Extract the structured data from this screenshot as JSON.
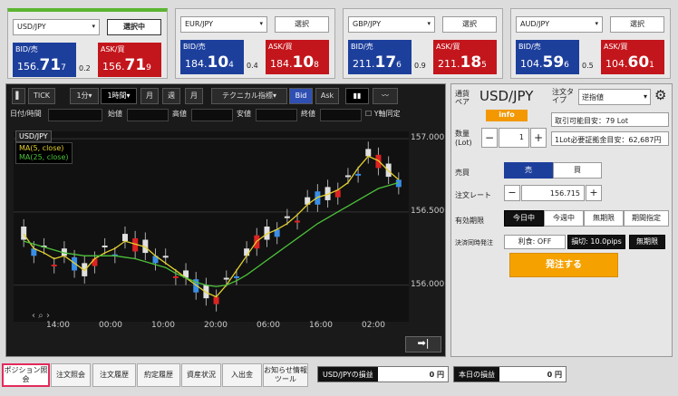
{
  "panels": [
    {
      "pair": "USD/JPY",
      "button": "選択中",
      "bid_label": "BID/売",
      "ask_label": "ASK/買",
      "bid": [
        "156.",
        "71",
        "7"
      ],
      "ask": [
        "156.",
        "71",
        "9"
      ],
      "spread": "0.2"
    },
    {
      "pair": "EUR/JPY",
      "button": "選択",
      "bid_label": "BID/売",
      "ask_label": "ASK/買",
      "bid": [
        "184.",
        "10",
        "4"
      ],
      "ask": [
        "184.",
        "10",
        "8"
      ],
      "spread": "0.4"
    },
    {
      "pair": "GBP/JPY",
      "button": "選択",
      "bid_label": "BID/売",
      "ask_label": "ASK/買",
      "bid": [
        "211.",
        "17",
        "6"
      ],
      "ask": [
        "211.",
        "18",
        "5"
      ],
      "spread": "0.9"
    },
    {
      "pair": "AUD/JPY",
      "button": "選択",
      "bid_label": "BID/売",
      "ask_label": "ASK/買",
      "bid": [
        "104.",
        "59",
        "6"
      ],
      "ask": [
        "104.",
        "60",
        "1"
      ],
      "spread": "0.5"
    }
  ],
  "chart_toolbar": {
    "tick": "TICK",
    "interval1": "1分",
    "interval2": "1時間",
    "month": "月",
    "week": "週",
    "month2": "月",
    "technical": "テクニカル指標",
    "bid": "Bid",
    "ask": "Ask"
  },
  "ohlc": {
    "datetime": "日付/時間",
    "open": "始値",
    "high": "高値",
    "low": "安値",
    "close": "終値",
    "sync": "Y軸同定"
  },
  "legend": {
    "pair": "USD/JPY",
    "ma5": "MA(5, close)",
    "ma25": "MA(25, close)"
  },
  "chart_data": {
    "type": "line",
    "y_ticks": [
      "157.000",
      "156.500",
      "156.000"
    ],
    "x_ticks": [
      "14:00",
      "00:00",
      "10:00",
      "20:00",
      "06:00",
      "16:00",
      "02:00"
    ],
    "ylim": [
      155.75,
      157.05
    ],
    "series": [
      {
        "name": "MA(5, close)",
        "color": "#e6d22d",
        "values": [
          156.35,
          156.25,
          156.22,
          156.18,
          156.2,
          156.15,
          156.1,
          156.18,
          156.22,
          156.25,
          156.3,
          156.28,
          156.26,
          156.2,
          156.15,
          156.1,
          156.05,
          156.0,
          155.95,
          155.92,
          156.0,
          156.1,
          156.2,
          156.3,
          156.35,
          156.38,
          156.42,
          156.48,
          156.55,
          156.6,
          156.62,
          156.65,
          156.7,
          156.8,
          156.88,
          156.85,
          156.78,
          156.72
        ]
      },
      {
        "name": "MA(25, close)",
        "color": "#4cc23a",
        "values": [
          156.3,
          156.28,
          156.26,
          156.24,
          156.22,
          156.21,
          156.2,
          156.2,
          156.2,
          156.2,
          156.19,
          156.18,
          156.16,
          156.14,
          156.12,
          156.08,
          156.05,
          156.02,
          156.0,
          155.99,
          156.0,
          156.03,
          156.07,
          156.12,
          156.17,
          156.22,
          156.27,
          156.32,
          156.37,
          156.42,
          156.46,
          156.5,
          156.54,
          156.58,
          156.62,
          156.66,
          156.68,
          156.7
        ]
      }
    ]
  },
  "order": {
    "pair_label": "通貨ペア",
    "pair": "USD/JPY",
    "type_label": "注文タイプ",
    "type": "逆指値",
    "info": "info",
    "tradable": "取引可能目安：79 Lot",
    "qty_label": "数量(Lot)",
    "qty": "1",
    "margin": "1Lot必要証拠金目安：62,687円",
    "side_label": "売買",
    "sell": "売",
    "buy": "買",
    "rate_label": "注文レート",
    "rate": "156.715",
    "validity_label": "有効期限",
    "v1": "今日中",
    "v2": "今週中",
    "v3": "無期限",
    "v4": "期間指定",
    "settle_label": "決済同時発注",
    "s1": "利食: OFF",
    "s2": "損切: 10.0pips",
    "s3": "無期限",
    "submit": "発注する"
  },
  "bottom": {
    "b1": "ポジション照会",
    "b2": "注文照会",
    "b3": "注文履歴",
    "b4": "約定履歴",
    "b5": "資産状況",
    "b6": "入出金",
    "b7": "お知らせ情報ツール",
    "pl1_label": "USD/JPYの損益",
    "pl1": "0 円",
    "pl2_label": "本日の損益",
    "pl2": "0 円"
  }
}
